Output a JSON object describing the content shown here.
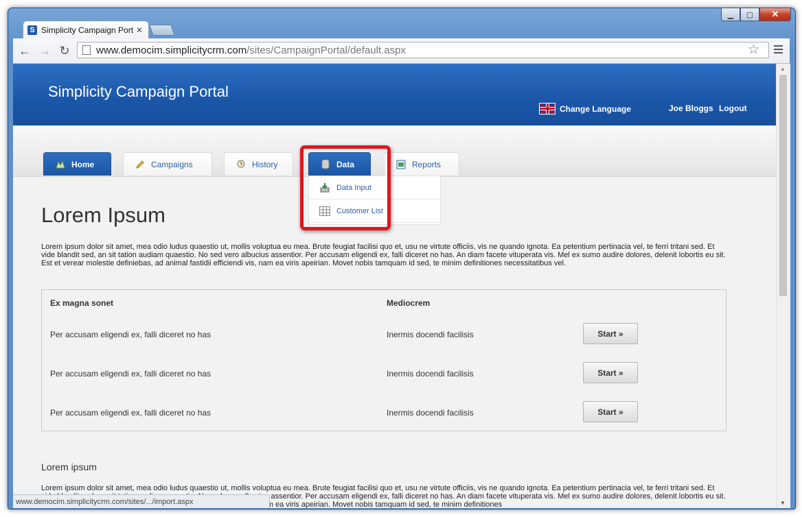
{
  "browser": {
    "tab_title": "Simplicity Campaign Port",
    "tab_favicon": "S",
    "url_host": "www.democim.simplicitycrm.com",
    "url_path": "/sites/CampaignPortal/default.aspx",
    "status_url": "www.democim.simplicitycrm.com/sites/.../import.aspx"
  },
  "header": {
    "title": "Simplicity Campaign Portal",
    "change_language": "Change Language",
    "user": "Joe Bloggs",
    "logout": "Logout"
  },
  "nav": {
    "tabs": [
      {
        "label": "Home",
        "icon": "home-icon"
      },
      {
        "label": "Campaigns",
        "icon": "pencil-icon"
      },
      {
        "label": "History",
        "icon": "history-icon"
      },
      {
        "label": "Data",
        "icon": "database-icon"
      },
      {
        "label": "Reports",
        "icon": "report-icon"
      }
    ],
    "dropdown": [
      {
        "label": "Data Input",
        "icon": "data-input-icon"
      },
      {
        "label": "Customer List",
        "icon": "grid-icon"
      }
    ]
  },
  "main": {
    "heading": "Lorem Ipsum",
    "intro": "Lorem ipsum dolor sit amet, mea odio ludus quaestio ut, mollis voluptua eu mea. Brute feugiat facilisi quo et, usu ne virtute officiis, vis ne quando ignota. Ea petentium pertinacia vel, te ferri tritani sed. Et vide blandit sed, an sit tation audiam quaestio. No sed vero albucius assentior. Per accusam eligendi ex, falli diceret no has. An diam facete vituperata vis. Mel ex sumo audire dolores, delenit lobortis eu sit. Est et verear molestie definiebas, ad animal fastidii efficiendi vis, nam ea viris apeirian. Movet nobis tamquam id sed, te minim definitiones necessitatibus vel.",
    "table": {
      "headers": [
        "Ex magna sonet",
        "Mediocrem"
      ],
      "rows": [
        {
          "col1": "Per accusam eligendi ex, falli diceret no has",
          "col2": "Inermis docendi facilisis",
          "button": "Start »"
        },
        {
          "col1": "Per accusam eligendi ex, falli diceret no has",
          "col2": "Inermis docendi facilisis",
          "button": "Start »"
        },
        {
          "col1": "Per accusam eligendi ex, falli diceret no has",
          "col2": "Inermis docendi facilisis",
          "button": "Start »"
        }
      ]
    },
    "subheading": "Lorem ipsum",
    "outro": "Lorem ipsum dolor sit amet, mea odio ludus quaestio ut, mollis voluptua eu mea. Brute feugiat facilisi quo et, usu ne virtute officiis, vis ne quando ignota. Ea petentium pertinacia vel, te ferri tritani sed. Et vide blandit sed, an sit tation audiam quaestio. No sed vero albucius assentior. Per accusam eligendi ex, falli diceret no has. An diam facete vituperata vis. Mel ex sumo audire dolores, delenit lobortis eu sit. Est et verear molestie definiebas, ad animal fastidii efficiendi vis, nam ea viris apeirian. Movet nobis tamquam id sed, te minim definitiones"
  },
  "colors": {
    "brand_blue": "#1a56a8",
    "highlight_red": "#e3151c"
  }
}
